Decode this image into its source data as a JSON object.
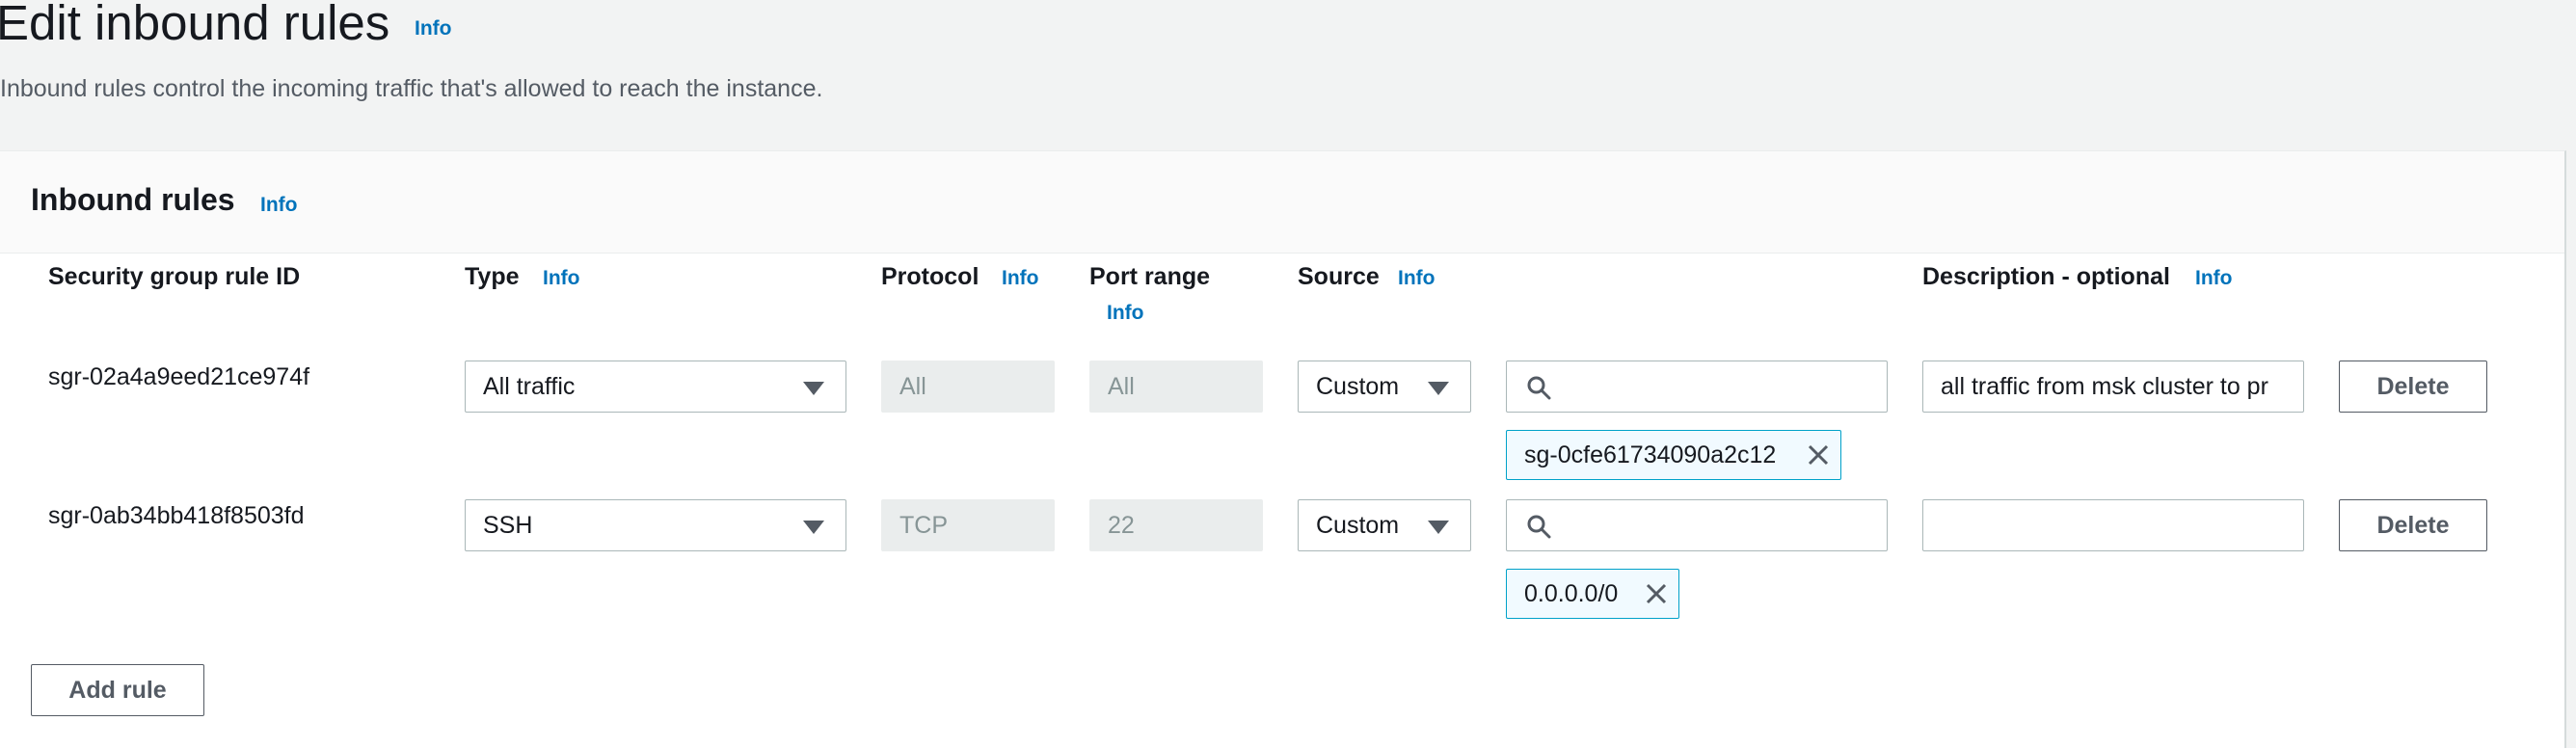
{
  "header": {
    "title": "Edit inbound rules",
    "info": "Info",
    "description": "Inbound rules control the incoming traffic that's allowed to reach the instance."
  },
  "panel": {
    "title": "Inbound rules",
    "info": "Info"
  },
  "columns": {
    "rule_id": "Security group rule ID",
    "type": "Type",
    "type_info": "Info",
    "protocol": "Protocol",
    "protocol_info": "Info",
    "port_range": "Port range",
    "port_range_info": "Info",
    "source": "Source",
    "source_info": "Info",
    "description": "Description - optional",
    "description_info": "Info"
  },
  "rules": [
    {
      "id": "sgr-02a4a9eed21ce974f",
      "type": "All traffic",
      "protocol": "All",
      "port_range": "All",
      "source_mode": "Custom",
      "search_value": "",
      "source_token": "sg-0cfe61734090a2c12",
      "description": "all traffic from msk cluster to pr",
      "delete_label": "Delete"
    },
    {
      "id": "sgr-0ab34bb418f8503fd",
      "type": "SSH",
      "protocol": "TCP",
      "port_range": "22",
      "source_mode": "Custom",
      "search_value": "",
      "source_token": "0.0.0.0/0",
      "description": "",
      "delete_label": "Delete"
    }
  ],
  "actions": {
    "add_rule": "Add rule"
  },
  "colors": {
    "link": "#0073bb",
    "token_border": "#00a1c9",
    "token_bg": "#f1faff",
    "page_bg": "#f2f3f3"
  }
}
